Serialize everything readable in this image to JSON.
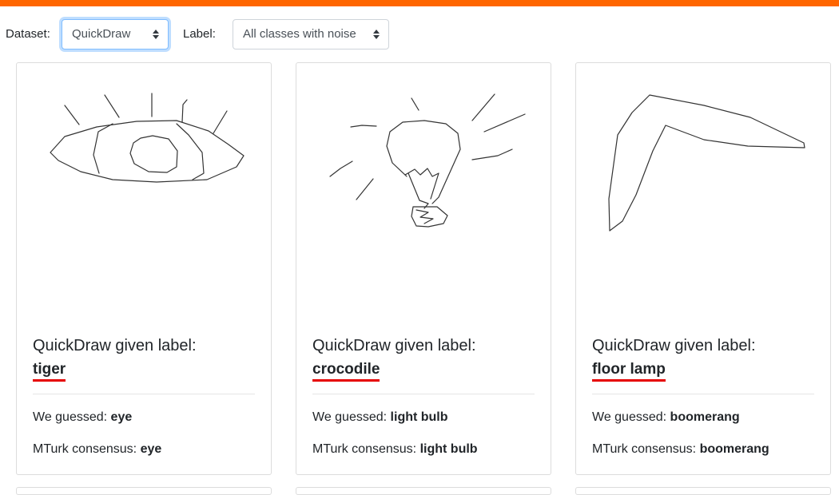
{
  "accent_color": "#ff6600",
  "label_underline_color": "#e60000",
  "filters": {
    "dataset_label": "Dataset:",
    "dataset_value": "QuickDraw",
    "label_label": "Label:",
    "label_value": "All classes with noise"
  },
  "cards": [
    {
      "given_text": "QuickDraw given label:",
      "given_label": "tiger",
      "guess_prefix": "We guessed:",
      "guess": "eye",
      "mturk_prefix": "MTurk consensus:",
      "mturk": "eye",
      "drawing_icon": "eye-sketch"
    },
    {
      "given_text": "QuickDraw given label:",
      "given_label": "crocodile",
      "guess_prefix": "We guessed:",
      "guess": "light bulb",
      "mturk_prefix": "MTurk consensus:",
      "mturk": "light bulb",
      "drawing_icon": "light-bulb-sketch"
    },
    {
      "given_text": "QuickDraw given label:",
      "given_label": "floor lamp",
      "guess_prefix": "We guessed:",
      "guess": "boomerang",
      "mturk_prefix": "MTurk consensus:",
      "mturk": "boomerang",
      "drawing_icon": "boomerang-sketch"
    }
  ]
}
